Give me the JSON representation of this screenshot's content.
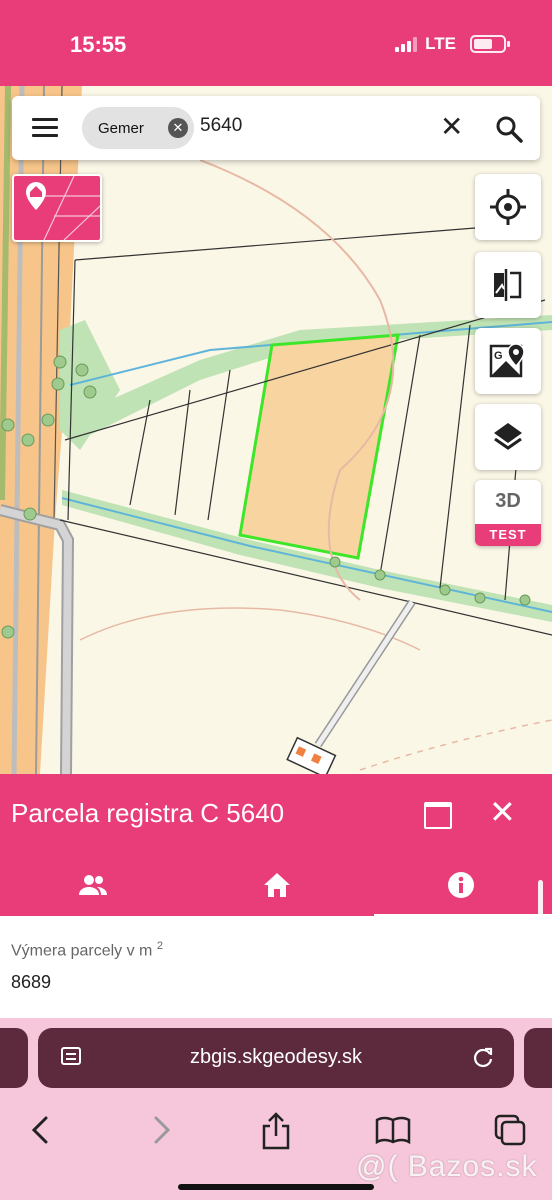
{
  "status_bar": {
    "time": "15:55",
    "network": "LTE"
  },
  "search": {
    "chip_label": "Gemer",
    "query": "5640"
  },
  "map_controls": {
    "three_d_label": "3D",
    "test_badge": "TEST"
  },
  "panel": {
    "title": "Parcela registra C 5640",
    "field_label": "Výmera parcely v m",
    "field_label_sup": "2",
    "field_value": "8689"
  },
  "browser": {
    "url": "zbgis.skgeodesy.sk"
  },
  "watermark": "@( Bazos.sk",
  "colors": {
    "accent": "#e83d78",
    "parcel_outline": "#3ee62a",
    "parcel_fill": "#f8d4a0",
    "browser_bar": "#5c2a3c"
  }
}
